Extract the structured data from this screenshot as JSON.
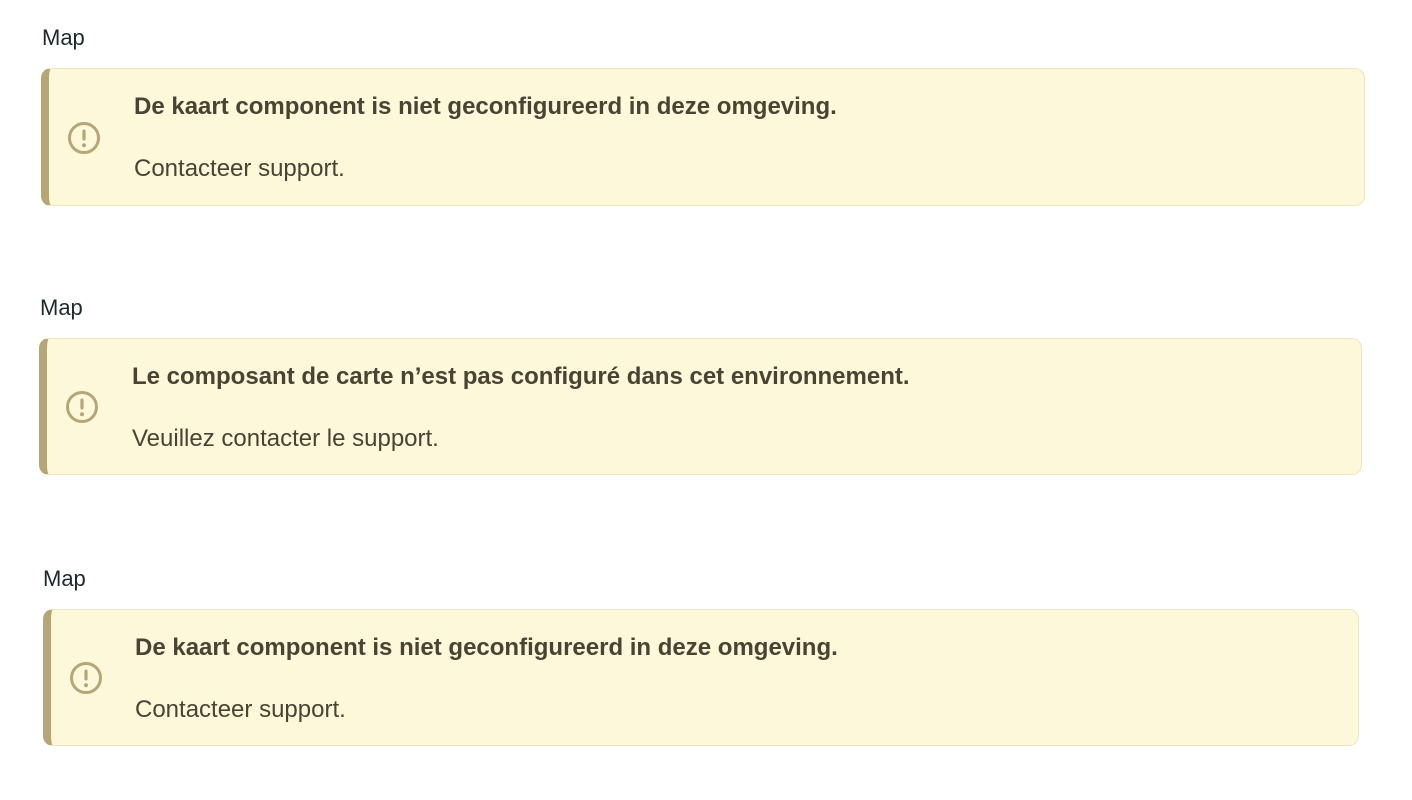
{
  "sections": [
    {
      "label": "Map",
      "alert": {
        "icon": "exclamation-circle-icon",
        "title": "De kaart component is niet geconfigureerd in deze omgeving.",
        "message": "Contacteer support."
      }
    },
    {
      "label": "Map",
      "alert": {
        "icon": "exclamation-circle-icon",
        "title": "Le composant de carte n’est pas configuré dans cet environnement.",
        "message": "Veuillez contacter le support."
      }
    },
    {
      "label": "Map",
      "alert": {
        "icon": "exclamation-circle-icon",
        "title": "De kaart component is niet geconfigureerd in deze omgeving.",
        "message": "Contacteer support."
      }
    }
  ],
  "colors": {
    "alert_background": "#fdf8da",
    "alert_border": "#ece5bd",
    "alert_accent": "#b6a676",
    "text": "#4a4232",
    "label_text": "#1e2a2a"
  }
}
